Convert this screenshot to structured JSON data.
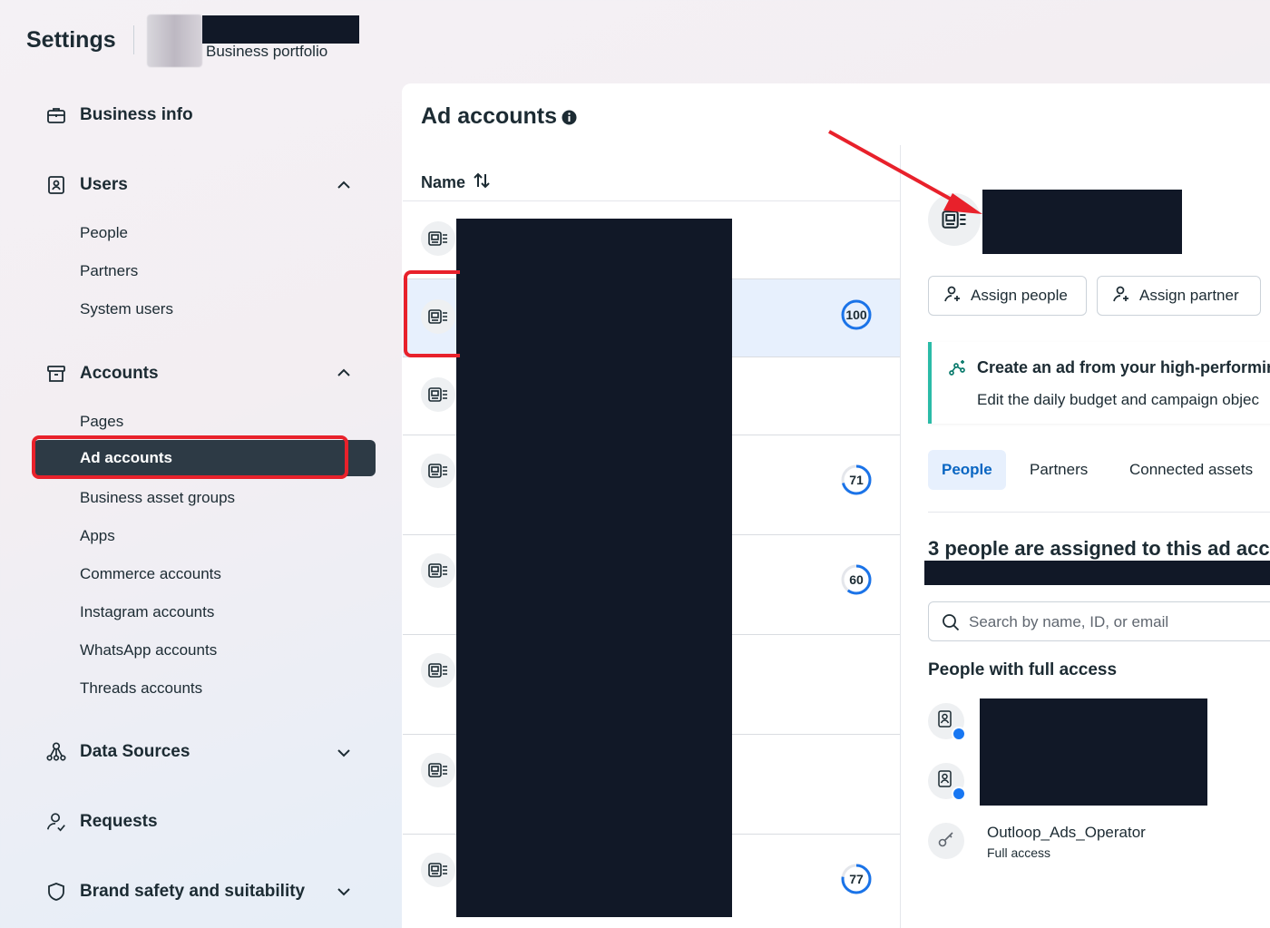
{
  "header": {
    "title": "Settings",
    "portfolio_label": "Business portfolio"
  },
  "sidebar": {
    "business_info": "Business info",
    "users": {
      "label": "Users",
      "items": [
        "People",
        "Partners",
        "System users"
      ]
    },
    "accounts": {
      "label": "Accounts",
      "items": [
        "Pages",
        "Ad accounts",
        "Business asset groups",
        "Apps",
        "Commerce accounts",
        "Instagram accounts",
        "WhatsApp accounts",
        "Threads accounts"
      ],
      "active": "Ad accounts"
    },
    "data_sources": "Data Sources",
    "requests": "Requests",
    "brand_safety": "Brand safety and suitability"
  },
  "main": {
    "title": "Ad accounts",
    "column_name": "Name",
    "rows": [
      {
        "score": ""
      },
      {
        "score": "100"
      },
      {
        "score": ""
      },
      {
        "score": "71"
      },
      {
        "score": "60"
      },
      {
        "score": ""
      },
      {
        "score": ""
      },
      {
        "score": "77"
      }
    ]
  },
  "details": {
    "assign_people": "Assign people",
    "assign_partner": "Assign partner",
    "promo_title": "Create an ad from your high-performir",
    "promo_text": "Edit the daily budget and campaign objec",
    "tabs": [
      "People",
      "Partners",
      "Connected assets"
    ],
    "active_tab": "People",
    "assigned_heading": "3 people are assigned to this ad acco",
    "search_placeholder": "Search by name, ID, or email",
    "full_access_heading": "People with full access",
    "operator_name": "Outloop_Ads_Operator",
    "operator_access": "Full access"
  },
  "colors": {
    "accent": "#0a66c2",
    "active_nav": "#2d3a45",
    "highlight_red": "#e8212b",
    "promo_border": "#2abba7",
    "score_ring": "#1a73e8"
  }
}
